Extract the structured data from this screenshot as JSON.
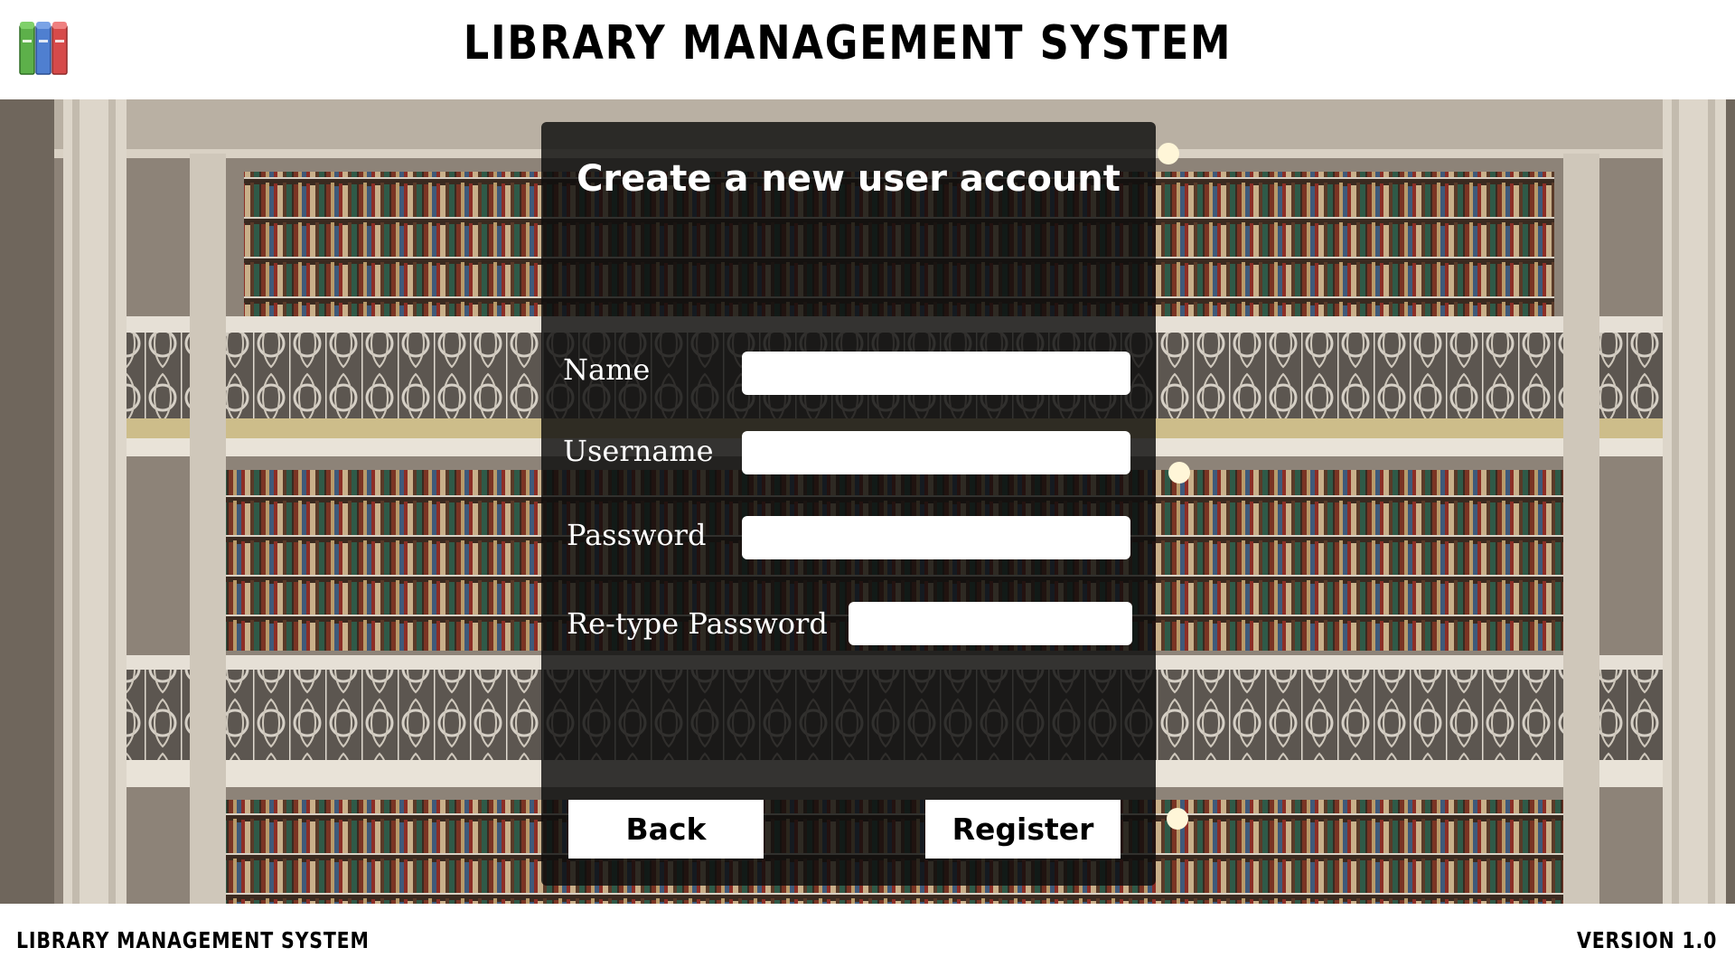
{
  "header": {
    "logo_icon": "books-icon",
    "title": "LIBRARY MANAGEMENT SYSTEM"
  },
  "background": {
    "description_icon": "library-interior-image"
  },
  "form": {
    "title": "Create a new user account",
    "fields": [
      {
        "label": "Name",
        "value": "",
        "placeholder": ""
      },
      {
        "label": "Username",
        "value": "",
        "placeholder": ""
      },
      {
        "label": "Password",
        "value": "",
        "placeholder": ""
      },
      {
        "label": "Re-type Password",
        "value": "",
        "placeholder": ""
      }
    ],
    "back_label": "Back",
    "register_label": "Register"
  },
  "footer": {
    "left": "LIBRARY MANAGEMENT SYSTEM",
    "right": "VERSION 1.0"
  },
  "colors": {
    "panel": "#0c0c0c",
    "input": "#ffffff",
    "button": "#ffffff"
  }
}
